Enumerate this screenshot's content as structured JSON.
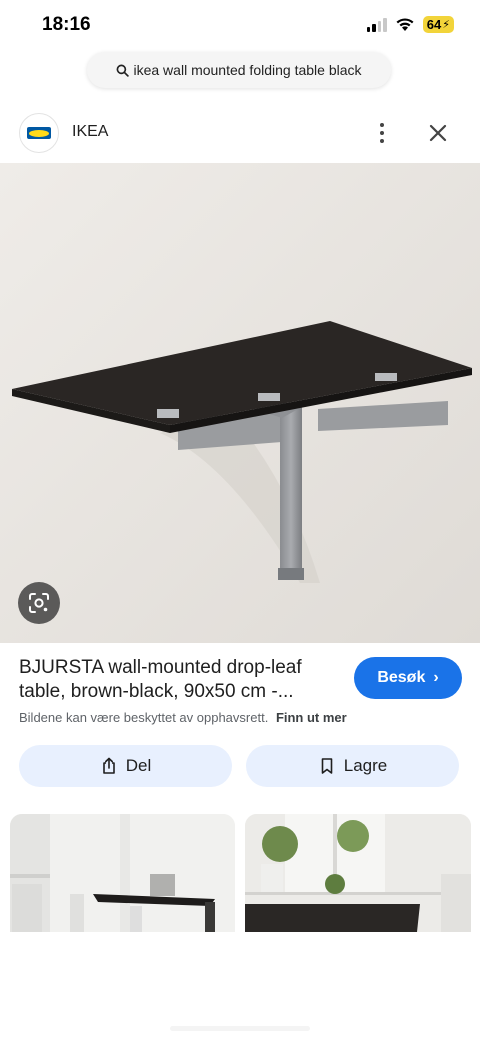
{
  "status_bar": {
    "time": "18:16",
    "battery": "64"
  },
  "search": {
    "query": "ikea wall mounted folding table black"
  },
  "source": {
    "name": "IKEA",
    "icons": [
      "more-vert-icon",
      "close-icon"
    ]
  },
  "result": {
    "title": "BJURSTA wall-mounted drop-leaf table, brown-black, 90x50 cm -...",
    "visit_label": "Besøk",
    "copyright_text": "Bildene kan være beskyttet av opphavsrett.",
    "learn_more": "Finn ut mer"
  },
  "actions": {
    "share_label": "Del",
    "save_label": "Lagre"
  },
  "colors": {
    "accent": "#1a73e8",
    "action_bg": "#e8f0fe",
    "battery": "#f2d43a"
  }
}
